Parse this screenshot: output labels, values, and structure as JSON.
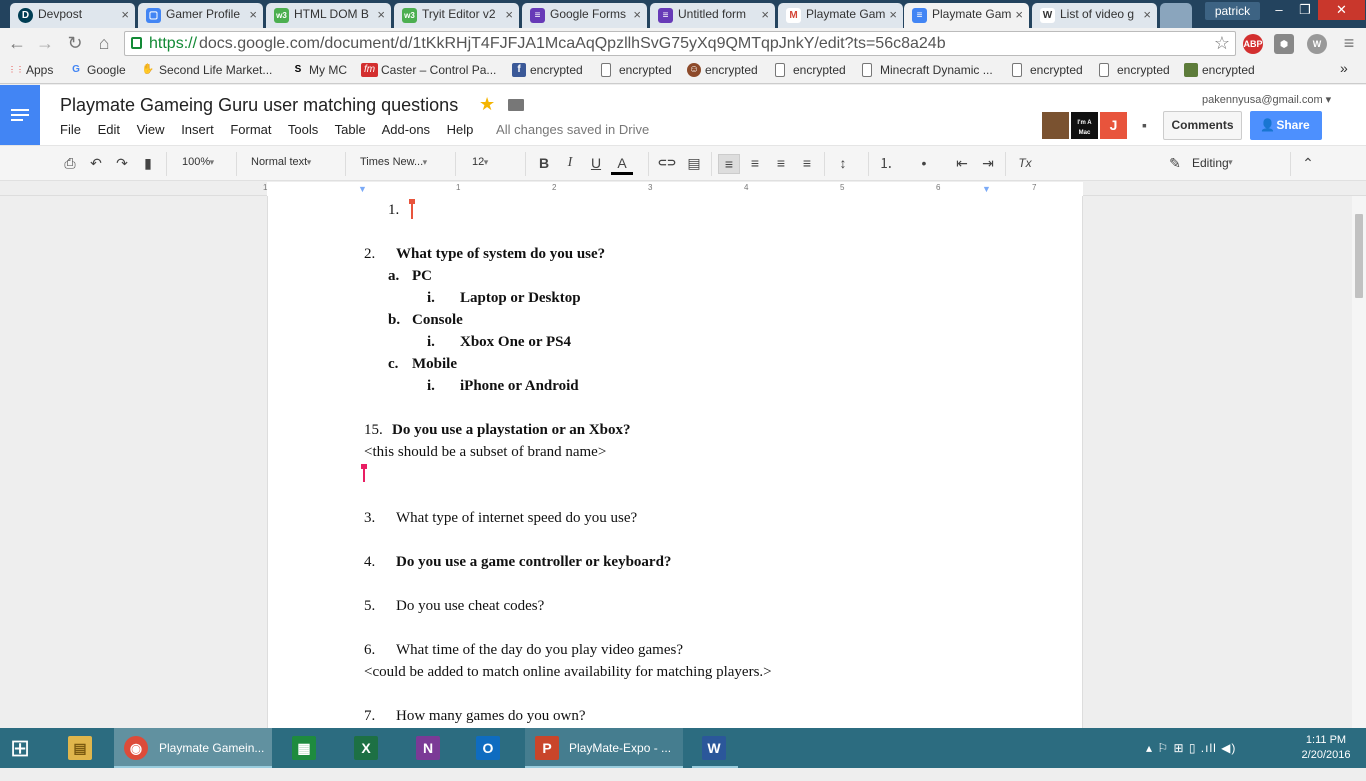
{
  "browser": {
    "tabs": [
      {
        "title": "Devpost",
        "icon": "D",
        "color": "#003e54"
      },
      {
        "title": "Gamer Profile",
        "icon": "▢",
        "color": "#4285f4"
      },
      {
        "title": "HTML DOM B",
        "icon": "w3",
        "color": "#4caf50"
      },
      {
        "title": "Tryit Editor v2",
        "icon": "w3",
        "color": "#4caf50"
      },
      {
        "title": "Google Forms",
        "icon": "≡",
        "color": "#673ab7"
      },
      {
        "title": "Untitled form",
        "icon": "≡",
        "color": "#673ab7"
      },
      {
        "title": "Playmate Gam",
        "icon": "M",
        "color": "#d44638"
      },
      {
        "title": "Playmate Gam",
        "icon": "≡",
        "color": "#4285f4"
      },
      {
        "title": "List of video g",
        "icon": "W",
        "color": "#555555"
      }
    ],
    "profile": "patrick",
    "window_buttons": {
      "minimize": "–",
      "restore": "❐",
      "close": "✕"
    },
    "nav": {
      "back": "←",
      "forward": "→",
      "reload": "↻",
      "home": "⌂"
    },
    "url_scheme": "https://",
    "url_rest": "docs.google.com/document/d/1tKkRHjT4FJFJA1McaAqQpzllhSvG75yXq9QMTqpJnkY/edit?ts=56c8a24b",
    "star": "☆",
    "extensions": [
      "ABP",
      "⬢",
      "W"
    ],
    "menu_icon": "≡",
    "bookmarks": [
      {
        "label": "Apps",
        "icon": "⋮⋮",
        "color": "#e53935"
      },
      {
        "label": "Google",
        "icon": "G",
        "color": "#4285f4"
      },
      {
        "label": "Second Life Market...",
        "icon": "✋",
        "color": "#444"
      },
      {
        "label": "My MC",
        "icon": "S",
        "color": "#000"
      },
      {
        "label": "Caster – Control Pa...",
        "icon": "fm",
        "color": "#d32f2f"
      },
      {
        "label": "encrypted",
        "icon": "f",
        "color": "#3b5998"
      },
      {
        "label": "encrypted",
        "icon": "",
        "color": "page"
      },
      {
        "label": "encrypted",
        "icon": "☺",
        "color": "#8d4a2a"
      },
      {
        "label": "encrypted",
        "icon": "",
        "color": "page"
      },
      {
        "label": "Minecraft Dynamic ...",
        "icon": "",
        "color": "page"
      },
      {
        "label": "encrypted",
        "icon": "",
        "color": "page"
      },
      {
        "label": "encrypted",
        "icon": "",
        "color": "page"
      },
      {
        "label": "encrypted",
        "icon": "■",
        "color": "#5d7c3a"
      }
    ],
    "bookmarks_more": "»"
  },
  "docs": {
    "title": "Playmate Gameing Guru user matching questions",
    "menus": [
      "File",
      "Edit",
      "View",
      "Insert",
      "Format",
      "Tools",
      "Table",
      "Add-ons",
      "Help"
    ],
    "saved_status": "All changes saved in Drive",
    "account": "pakennyusa@gmail.com",
    "avatars": [
      {
        "label": "",
        "color": "#7a5230"
      },
      {
        "label": "I'm A Mac",
        "color": "#111"
      },
      {
        "label": "J",
        "color": "#e8543c"
      }
    ],
    "comments": "Comments",
    "share": "Share",
    "toolbar": {
      "zoom": "100%",
      "style": "Normal text",
      "font": "Times New...",
      "size": "12",
      "bold": "B",
      "italic": "I",
      "underline": "U",
      "color": "A",
      "mode": "Editing",
      "icons": {
        "print": "⎙",
        "undo": "↶",
        "redo": "↷",
        "paint": "▮",
        "link": "⊂⊃",
        "comment": "▤",
        "align_left": "≡",
        "align_center": "≡",
        "align_right": "≡",
        "justify": "≡",
        "spacing": "↕",
        "numbered": "⒈",
        "bulleted": "•",
        "outdent": "⇤",
        "indent": "⇥",
        "clear": "Tx",
        "pencil": "✎",
        "collapse": "⌃"
      }
    },
    "ruler": [
      "1",
      "1",
      "2",
      "3",
      "4",
      "5",
      "6",
      "7"
    ],
    "content": [
      {
        "num": "1.",
        "text": ""
      },
      {
        "num": "2.",
        "text": "What type of system do you use?"
      },
      {
        "num": "a.",
        "text": "PC"
      },
      {
        "num": "i.",
        "text": "Laptop or Desktop"
      },
      {
        "num": "b.",
        "text": "Console"
      },
      {
        "num": "i.",
        "text": "Xbox One or PS4"
      },
      {
        "num": "c.",
        "text": "Mobile"
      },
      {
        "num": "i.",
        "text": "iPhone or Android"
      },
      {
        "num": "15.",
        "text": "Do you use a playstation or an Xbox?"
      },
      {
        "num": "",
        "text": "<this should be a subset of brand name>"
      },
      {
        "num": "3.",
        "text": "What type of internet speed do you use?"
      },
      {
        "num": "4.",
        "text": "Do you use a game controller or keyboard?"
      },
      {
        "num": "5.",
        "text": "Do you use cheat codes?"
      },
      {
        "num": "6.",
        "text": "What time of the day do you play video games?"
      },
      {
        "num": "",
        "text": "<could be added to match online availability for matching players.>"
      },
      {
        "num": "7.",
        "text": "How many games do you own?"
      }
    ]
  },
  "taskbar": {
    "start": "⊞",
    "apps": [
      {
        "label": "",
        "icon": "▤",
        "color": "#e0b64c"
      },
      {
        "label": "Playmate Gamein...",
        "icon": "◉",
        "color": "#dd4b39"
      },
      {
        "label": "",
        "icon": "▦",
        "color": "#1e8b3e"
      },
      {
        "label": "",
        "icon": "X",
        "color": "#1d7044"
      },
      {
        "label": "",
        "icon": "N",
        "color": "#7b3a96"
      },
      {
        "label": "",
        "icon": "O",
        "color": "#0f6cc0"
      },
      {
        "label": "PlayMate-Expo - ...",
        "icon": "P",
        "color": "#c9452a"
      },
      {
        "label": "",
        "icon": "W",
        "color": "#2b579a"
      }
    ],
    "tray": "▴  ⚐  ⊞  ▯  .ıll  ◀)",
    "time": "1:11 PM",
    "date": "2/20/2016"
  }
}
